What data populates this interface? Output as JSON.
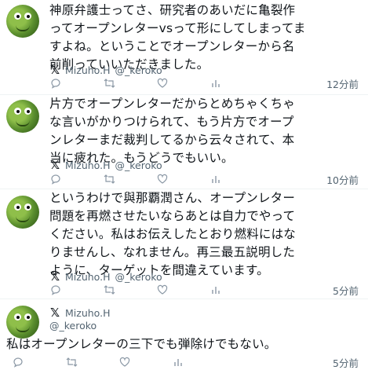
{
  "posts": [
    {
      "lines": [
        "神原弁護士ってさ、研究者のあいだに亀裂作",
        "ってオープンレターvsって形にしてしまってま",
        "すよね。ということでオープンレターから名",
        "前削っていいただきました。"
      ],
      "quote_name": "Mizuho.H",
      "quote_handle": "@_keroko",
      "time": "12分前"
    },
    {
      "lines": [
        "片方でオープンレターだからとめちゃくちゃ",
        "な言いがかりつけられて、もう片方でオープ",
        "ンレターまだ裁判してるから云々されて、本",
        "当に疲れた。もうどうでもいい。"
      ],
      "quote_name": "Mizuho.H",
      "quote_handle": "@_keroko",
      "time": "10分前"
    },
    {
      "lines": [
        "というわけで與那覇潤さん、オープンレター",
        "問題を再燃させたいならあとは自力でやって",
        "ください。私はお伝えしたとおり燃料にはな",
        "りませんし、なれません。再三最五説明した",
        "ように、ターゲットを間違えています。"
      ],
      "quote_name": "Mizuho.H",
      "quote_handle": "@_keroko",
      "time": "5分前"
    },
    {
      "name": "Mizuho.H",
      "handle": "@_keroko",
      "lines": [
        "私はオープンレターの三下でも弾除けでもない。"
      ],
      "time": "5分前"
    }
  ],
  "icons": {
    "x_logo": "𝕏",
    "reply": "reply-icon",
    "repost": "repost-icon",
    "like": "like-icon",
    "stats": "stats-icon"
  },
  "colors": {
    "muted": "#536471",
    "divider": "#eff3f4",
    "avatar": "#5b8f2e"
  }
}
